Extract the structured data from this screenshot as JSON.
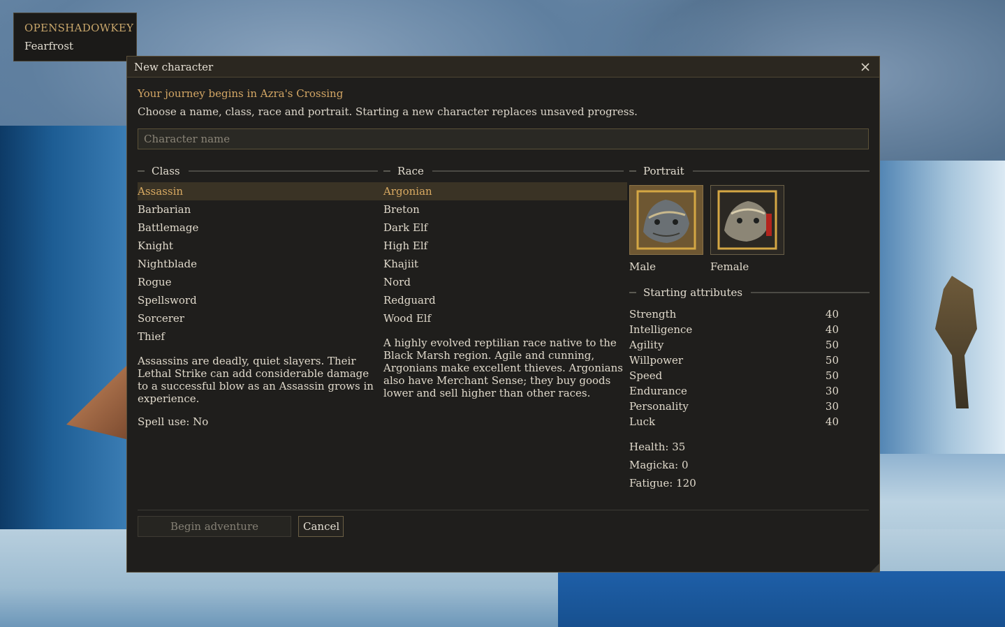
{
  "profile": {
    "account": "OPENSHADOWKEY",
    "character": "Fearfrost"
  },
  "dialog": {
    "title": "New character",
    "close_icon": "close-icon",
    "journey": "Your journey begins in Azra's Crossing",
    "intro": "Choose a name, class, race and portrait. Starting a new character replaces unsaved progress.",
    "name_placeholder": "Character name",
    "name_value": ""
  },
  "class_section": {
    "heading": "Class",
    "selected": "Assassin",
    "items": [
      "Assassin",
      "Barbarian",
      "Battlemage",
      "Knight",
      "Nightblade",
      "Rogue",
      "Spellsword",
      "Sorcerer",
      "Thief"
    ],
    "description": "Assassins are deadly, quiet slayers. Their Lethal Strike can add considerable damage to a successful blow as an Assassin grows in experience.",
    "spell_use": "Spell use: No"
  },
  "race_section": {
    "heading": "Race",
    "selected": "Argonian",
    "items": [
      "Argonian",
      "Breton",
      "Dark Elf",
      "High Elf",
      "Khajiit",
      "Nord",
      "Redguard",
      "Wood Elf"
    ],
    "description": "A highly evolved reptilian race native to the Black Marsh region. Agile and cunning, Argonians make excellent thieves. Argonians also have Merchant Sense; they buy goods lower and sell higher than other races."
  },
  "portrait_section": {
    "heading": "Portrait",
    "selected": "Male",
    "options": [
      {
        "label": "Male",
        "icon": "argonian-male-portrait-icon"
      },
      {
        "label": "Female",
        "icon": "argonian-female-portrait-icon"
      }
    ]
  },
  "attributes_section": {
    "heading": "Starting attributes",
    "items": [
      {
        "name": "Strength",
        "value": "40"
      },
      {
        "name": "Intelligence",
        "value": "40"
      },
      {
        "name": "Agility",
        "value": "50"
      },
      {
        "name": "Willpower",
        "value": "50"
      },
      {
        "name": "Speed",
        "value": "50"
      },
      {
        "name": "Endurance",
        "value": "30"
      },
      {
        "name": "Personality",
        "value": "30"
      },
      {
        "name": "Luck",
        "value": "40"
      }
    ],
    "health": "Health: 35",
    "magicka": "Magicka: 0",
    "fatigue": "Fatigue: 120"
  },
  "buttons": {
    "begin": "Begin adventure",
    "cancel": "Cancel"
  },
  "colors": {
    "accent": "#d9aa62",
    "panel": "#1f1e1c",
    "selected_row": "#3a3325"
  }
}
